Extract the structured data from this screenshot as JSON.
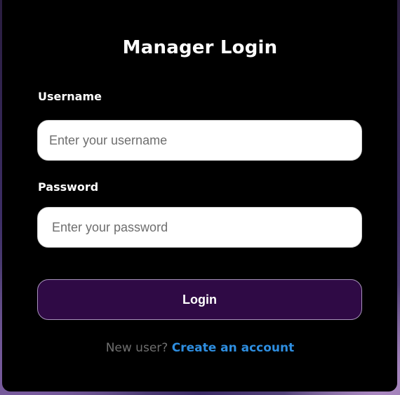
{
  "login": {
    "title": "Manager Login",
    "username_label": "Username",
    "username_placeholder": "Enter your username",
    "password_label": "Password",
    "password_placeholder": "Enter your password",
    "submit_label": "Login",
    "signup_prefix": "New user?",
    "signup_link": "Create an account"
  },
  "colors": {
    "card_background": "#000000",
    "button_background": "#2f0a45",
    "link": "#2e8ee0"
  }
}
